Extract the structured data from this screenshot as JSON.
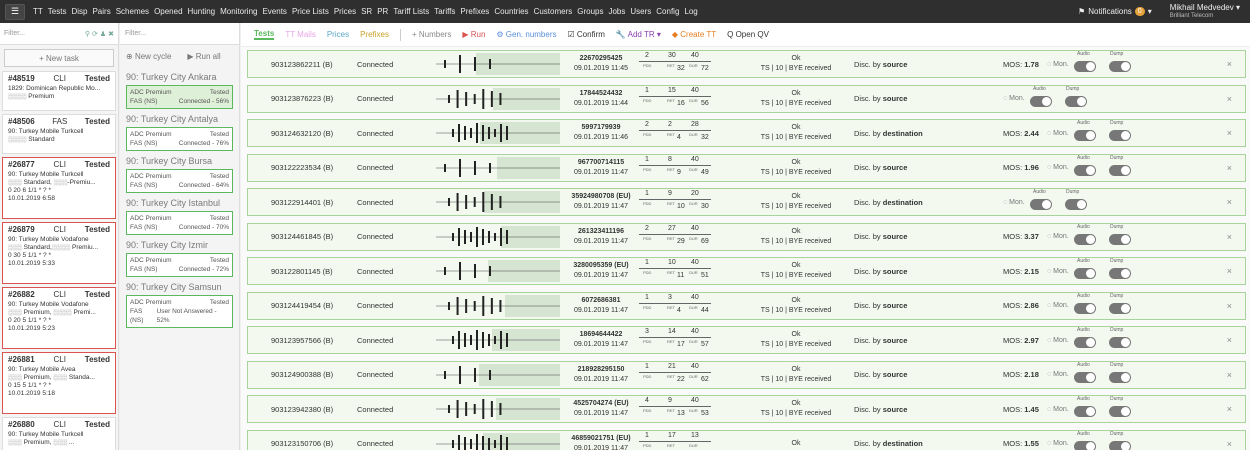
{
  "nav": {
    "menu_icon": "hamburger-icon",
    "items": [
      "TT",
      "Tests",
      "Disp",
      "Pairs",
      "Schemes",
      "Opened",
      "Hunting",
      "Monitoring",
      "Events",
      "Price Lists",
      "Prices",
      "SR",
      "PR",
      "Tariff Lists",
      "Tariffs",
      "Prefixes",
      "Countries",
      "Customers",
      "Groups",
      "Jobs",
      "Users",
      "Config",
      "Log"
    ],
    "notifications_label": "Notifications",
    "notifications_count": "0",
    "user_name": "Mikhail Medvedev",
    "company": "Brilliant Telecom"
  },
  "tasks_panel": {
    "filter_placeholder": "Filter...",
    "new_task_label": "+ New task",
    "tasks": [
      {
        "id": "#48519",
        "kind": "CLI",
        "status": "Tested",
        "line1": "1829: Dominican Republic Mo...",
        "line2": "░░░░ Premium",
        "line3": "",
        "line4": ""
      },
      {
        "id": "#48506",
        "kind": "FAS",
        "status": "Tested",
        "line1": "90: Turkey Mobile Turkcell",
        "line2": "░░░░ Standard",
        "line3": "",
        "line4": ""
      },
      {
        "id": "#26877",
        "kind": "CLI",
        "status": "Tested",
        "line1": "90: Turkey Mobile Turkcell",
        "line2": "░░░ Standard, ░░░-Premiu...",
        "line3": "0 20 6 1/1 * ? *",
        "line4": "10.01.2019 6:58"
      },
      {
        "id": "#26879",
        "kind": "CLI",
        "status": "Tested",
        "line1": "90: Turkey Mobile Vodafone",
        "line2": "░░░ Standard,░░░░ Premiu...",
        "line3": "0 30 5 1/1 * ? *",
        "line4": "10.01.2019 5:33"
      },
      {
        "id": "#26882",
        "kind": "CLI",
        "status": "Tested",
        "line1": "90: Turkey Mobile Vodafone",
        "line2": "░░░ Premium, ░░░░ Premi...",
        "line3": "0 20 5 1/1 * ? *",
        "line4": "10.01.2019 5:23"
      },
      {
        "id": "#26881",
        "kind": "CLI",
        "status": "Tested",
        "line1": "90: Turkey Mobile Avea",
        "line2": "░░░ Premium, ░░░ Standa...",
        "line3": "0 15 5 1/1 * ? *",
        "line4": "10.01.2019 5:18"
      },
      {
        "id": "#26880",
        "kind": "CLI",
        "status": "Tested",
        "line1": "90: Turkey Mobile Turkcell",
        "line2": "░░░ Premium, ░░░ ...",
        "line3": "",
        "line4": ""
      }
    ]
  },
  "cycles_panel": {
    "filter_placeholder": "Filter...",
    "new_cycle_label": "New cycle",
    "run_all_label": "Run all",
    "cycles": [
      {
        "title": "90: Turkey City Ankara",
        "product": "ADC Premium",
        "state": "Tested",
        "type": "FAS (NS)",
        "result": "Connected - 56%"
      },
      {
        "title": "90: Turkey City Antalya",
        "product": "ADC Premium",
        "state": "Tested",
        "type": "FAS (NS)",
        "result": "Connected - 76%"
      },
      {
        "title": "90: Turkey City Bursa",
        "product": "ADC Premium",
        "state": "Tested",
        "type": "FAS (NS)",
        "result": "Connected - 64%"
      },
      {
        "title": "90: Turkey City Istanbul",
        "product": "ADC Premium",
        "state": "Tested",
        "type": "FAS (NS)",
        "result": "Connected - 70%"
      },
      {
        "title": "90: Turkey City Izmir",
        "product": "ADC Premium",
        "state": "Tested",
        "type": "FAS (NS)",
        "result": "Connected - 72%"
      },
      {
        "title": "90: Turkey City Samsun",
        "product": "ADC Premium",
        "state": "Tested",
        "type": "FAS (NS)",
        "result": "User Not Answered - 52%"
      }
    ]
  },
  "toolbar": {
    "tests": "Tests",
    "tt_mails": "TT Mails",
    "prices": "Prices",
    "prefixes": "Prefixes",
    "numbers": "+ Numbers",
    "run": "▶ Run",
    "gen_numbers": "⚙ Gen. numbers",
    "confirm": "☑ Confirm",
    "add_tr": "🔧 Add TR ▾",
    "create_tt": "◆ Create TT",
    "open_qv": "Q Open QV"
  },
  "labels": {
    "pdd": "PDD",
    "ret": "RET",
    "dur": "DUR",
    "mon": "Mon.",
    "audio": "Audio",
    "dump": "Dump",
    "mos": "MOS:",
    "disc_by": "Disc. by",
    "close": "×"
  },
  "calls": [
    {
      "number": "903123862211 (B)",
      "status": "Connected",
      "id": "22670295425",
      "time": "09.01.2019 11:45",
      "pdd": "2",
      "ret_top": "30",
      "dur_top": "40",
      "ret": "32",
      "dur": "72",
      "ok": "Ok",
      "ok_detail": "TS | 10 | BYE received",
      "disc": "source",
      "mos": "1.78"
    },
    {
      "number": "903123876223 (B)",
      "status": "Connected",
      "id": "17844524432",
      "time": "09.01.2019 11:44",
      "pdd": "1",
      "ret_top": "15",
      "dur_top": "40",
      "ret": "16",
      "dur": "56",
      "ok": "Ok",
      "ok_detail": "TS | 10 | BYE received",
      "disc": "source",
      "mos": ""
    },
    {
      "number": "903124632120 (B)",
      "status": "Connected",
      "id": "5997179939",
      "time": "09.01.2019 11:46",
      "pdd": "2",
      "ret_top": "2",
      "dur_top": "28",
      "ret": "4",
      "dur": "32",
      "ok": "Ok",
      "ok_detail": "TS | 10 | BYE received",
      "disc": "destination",
      "mos": "2.44"
    },
    {
      "number": "903122223534 (B)",
      "status": "Connected",
      "id": "967700714115",
      "time": "09.01.2019 11:47",
      "pdd": "1",
      "ret_top": "8",
      "dur_top": "40",
      "ret": "9",
      "dur": "49",
      "ok": "Ok",
      "ok_detail": "TS | 10 | BYE received",
      "disc": "source",
      "mos": "1.96"
    },
    {
      "number": "903122914401 (B)",
      "status": "Connected",
      "id": "35924980708 (EU)",
      "time": "09.01.2019 11:47",
      "pdd": "1",
      "ret_top": "9",
      "dur_top": "20",
      "ret": "10",
      "dur": "30",
      "ok": "Ok",
      "ok_detail": "TS | 10 | BYE received",
      "disc": "destination",
      "mos": ""
    },
    {
      "number": "903124461845 (B)",
      "status": "Connected",
      "id": "261323411196",
      "time": "09.01.2019 11:47",
      "pdd": "2",
      "ret_top": "27",
      "dur_top": "40",
      "ret": "29",
      "dur": "69",
      "ok": "Ok",
      "ok_detail": "TS | 10 | BYE received",
      "disc": "source",
      "mos": "3.37"
    },
    {
      "number": "903122801145 (B)",
      "status": "Connected",
      "id": "3280095359 (EU)",
      "time": "09.01.2019 11:47",
      "pdd": "1",
      "ret_top": "10",
      "dur_top": "40",
      "ret": "11",
      "dur": "51",
      "ok": "Ok",
      "ok_detail": "TS | 10 | BYE received",
      "disc": "source",
      "mos": "2.15"
    },
    {
      "number": "903124419454 (B)",
      "status": "Connected",
      "id": "6072686381",
      "time": "09.01.2019 11:47",
      "pdd": "1",
      "ret_top": "3",
      "dur_top": "40",
      "ret": "4",
      "dur": "44",
      "ok": "Ok",
      "ok_detail": "TS | 10 | BYE received",
      "disc": "source",
      "mos": "2.86"
    },
    {
      "number": "903123957566 (B)",
      "status": "Connected",
      "id": "18694644422",
      "time": "09.01.2019 11:47",
      "pdd": "3",
      "ret_top": "14",
      "dur_top": "40",
      "ret": "17",
      "dur": "57",
      "ok": "Ok",
      "ok_detail": "TS | 10 | BYE received",
      "disc": "source",
      "mos": "2.97"
    },
    {
      "number": "903124900388 (B)",
      "status": "Connected",
      "id": "218928295150",
      "time": "09.01.2019 11:47",
      "pdd": "1",
      "ret_top": "21",
      "dur_top": "40",
      "ret": "22",
      "dur": "62",
      "ok": "Ok",
      "ok_detail": "TS | 10 | BYE received",
      "disc": "source",
      "mos": "2.18"
    },
    {
      "number": "903123942380 (B)",
      "status": "Connected",
      "id": "4525704274 (EU)",
      "time": "09.01.2019 11:47",
      "pdd": "4",
      "ret_top": "9",
      "dur_top": "40",
      "ret": "13",
      "dur": "53",
      "ok": "Ok",
      "ok_detail": "TS | 10 | BYE received",
      "disc": "source",
      "mos": "1.45"
    },
    {
      "number": "903123150706 (B)",
      "status": "Connected",
      "id": "46859021751 (EU)",
      "time": "09.01.2019 11:47",
      "pdd": "1",
      "ret_top": "17",
      "dur_top": "13",
      "ret": "",
      "dur": "",
      "ok": "Ok",
      "ok_detail": "",
      "disc": "destination",
      "mos": "1.55"
    }
  ],
  "colors": {
    "accent_green": "#5cb85c",
    "nav_bg": "#2f2f2f",
    "tt_mails": "#e7a5e7",
    "prices": "#5aa7c7",
    "prefixes": "#c9a227",
    "run": "#d9534f",
    "gen_numbers": "#5b8fd9",
    "add_tr": "#8a3fb0",
    "create_tt": "#e67e22"
  }
}
